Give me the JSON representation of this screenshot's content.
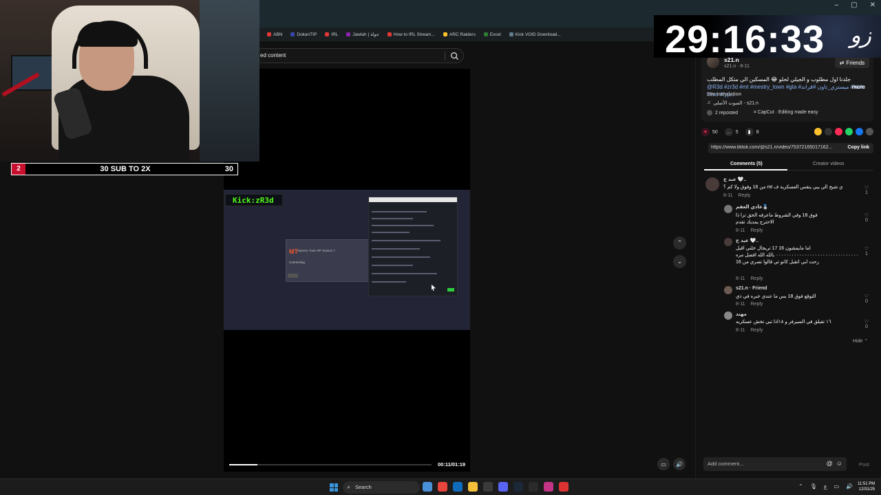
{
  "browser": {
    "window_controls": [
      "–",
      "▢",
      "✕"
    ],
    "bookmarks": [
      {
        "label": "ABN",
        "color": "#e53935"
      },
      {
        "label": "DokanTIP",
        "color": "#3949ab"
      },
      {
        "label": "IRL",
        "color": "#e53935"
      },
      {
        "label": "Jawlah | جولة",
        "color": "#8e24aa"
      },
      {
        "label": "How to IRL Stream...",
        "color": "#e53935"
      },
      {
        "label": "ARC Raiders",
        "color": "#fbc02d"
      },
      {
        "label": "Excel",
        "color": "#2e7d32"
      },
      {
        "label": "Kick VOID Download...",
        "color": "#607d8b"
      }
    ]
  },
  "search": {
    "text": "ed content"
  },
  "video": {
    "kick_tag": "Kick:zR3d",
    "game_logo": "MT",
    "game_title": "Mystery Town RP Season 7",
    "game_status": "Connecting",
    "time": "00:11/01:19",
    "progress": 0.14
  },
  "nav": {
    "up": "⌃",
    "down": "⌄"
  },
  "post": {
    "author": "s21.n",
    "author_sub": "s21.n · 8-11",
    "friends_label": "Friends",
    "caption": "جلدنا اول مطلوب و الجيلي لحلو 😂 المسكين الي متكل المطلب",
    "caption_tags": "@R3d #zr3d #mt #mestry_town #gta #ميستري_تاون #قراند #kick #live #fyp...",
    "more": "more",
    "see_translation": "See translation",
    "sound": "الصوت الأصلي - s21.n",
    "reposted": "2 reposted",
    "capcut": "CapCut · Editing made easy",
    "likes": "50",
    "comments_count": "5",
    "saves": "8",
    "link": "https://www.tiktok.com/@s21.n/video/75372165017162...",
    "copy_link": "Copy link",
    "tab_comments": "Comments (5)",
    "tab_creator": "Creator videos"
  },
  "comments": [
    {
      "name": "عبد ح 🤍..",
      "text": "ي شيخ الي يبي ينقس العسكرية ف mt من 16 وفوق ولا كم ؟",
      "meta": "8-11",
      "reply": "Reply",
      "likes": "1"
    },
    {
      "name": "عادي العقم🥈",
      "text": "فوق 18 وفي الشروط ماعرفه الحق ترا ذا الاحترج يمديك تقدم",
      "meta": "8-11",
      "reply": "Reply",
      "likes": "0"
    },
    {
      "name": "عبد ح 🤍..",
      "text": "اما مايمشون 16 17 تريجال خلني اقبل ٠٠٠٠٠٠٠٠٠٠٠٠٠٠٠٠٠٠٠٠٠٠٠٠٠٠٠٠٠٠٠٠ بالله الله افضل مره رحت ابي اتقبل كانو تي قالوا تصري من 16",
      "meta": "8-11",
      "reply": "Reply",
      "likes": "1"
    },
    {
      "name": "s21.n · Friend",
      "text": "التوقع فوق 18 بس ما عندي خبره في ذي",
      "meta": "8-11",
      "reply": "Reply",
      "likes": "0"
    },
    {
      "name": "مهند",
      "text": "١٦ تقبلق في السيرفر و ١٨اذا تبي تخش عسكريه",
      "meta": "8-11",
      "reply": "Reply",
      "likes": "0"
    }
  ],
  "hide_label": "Hide ⌃",
  "add_comment": {
    "placeholder": "Add comment...",
    "post": "Post"
  },
  "overlay": {
    "subgoal_count": "2",
    "subgoal_text": "30 SUB TO 2X",
    "subgoal_target": "30",
    "timer": "29:16:33",
    "timer_logo": "زو"
  },
  "taskbar": {
    "search": "Search",
    "time": "11:51 PM",
    "date": "12/31/25",
    "lang": "ع"
  }
}
